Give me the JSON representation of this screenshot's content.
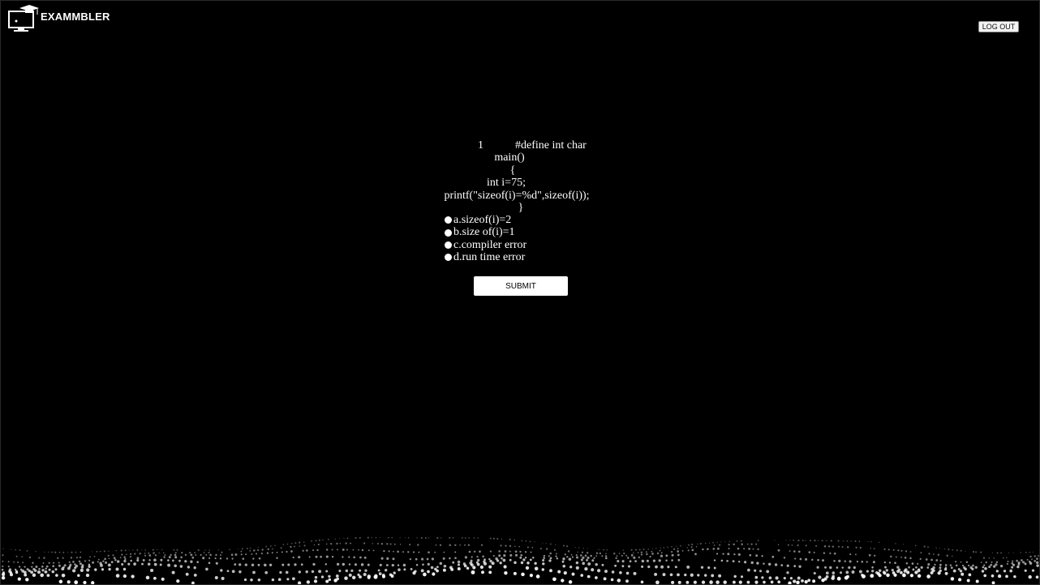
{
  "brand": {
    "name": "EXAMMBLER",
    "icon": "monitor-graduation-cap-icon"
  },
  "header": {
    "logout_label": "LOG OUT"
  },
  "question": {
    "number": "1",
    "code_lines": [
      "#define int char",
      "main()",
      "{",
      "int i=75;",
      "printf(\"sizeof(i)=%d\",sizeof(i));",
      "}"
    ],
    "options": [
      "a.sizeof(i)=2",
      "b.size of(i)=1",
      "c.compiler error",
      "d.run time error"
    ]
  },
  "actions": {
    "submit_label": "SUBMIT"
  },
  "colors": {
    "background": "#000000",
    "text": "#ffffff",
    "button": "#ffffff"
  }
}
